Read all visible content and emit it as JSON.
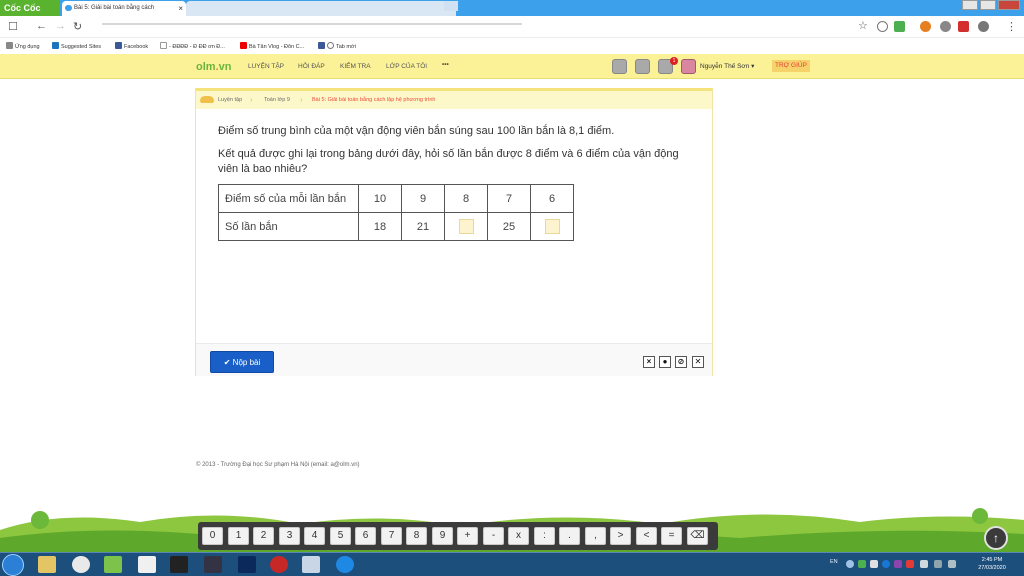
{
  "browser": {
    "brand": "Cốc Cốc",
    "tab_title": "Bài 5: Giải bài toán bằng cách",
    "tab_close": "×"
  },
  "bookmarks": [
    "Ứng dụng",
    "Suggested Sites",
    "Facebook",
    "- ĐĐĐĐ - Đ ĐĐ ơn Đ...",
    "Bà Tân Vlog - Đôn C...",
    "Tab mới"
  ],
  "site": {
    "logo_a": "olm",
    "logo_dot": ".",
    "logo_b": "vn",
    "nav": [
      "LUYỆN TẬP",
      "HỎI ĐÁP",
      "KIỂM TRA",
      "LỚP CỦA TÔI",
      "•••"
    ],
    "notification_count": "1",
    "user_name": "Nguyễn Thế Sơn ▾",
    "help": "TRỢ GIÚP"
  },
  "breadcrumb": [
    "Luyện tập",
    "Toán lớp 9",
    "Bài 5: Giải bài toán bằng cách lập hệ phương trình"
  ],
  "question": {
    "line1": "Điểm số trung bình của một vận động viên bắn súng sau 100 lần bắn là 8,1 điểm.",
    "line2": "Kết quả được ghi lại trong bảng dưới đây, hỏi số lần bắn được 8 điểm và 6 điểm của vận động viên là bao nhiêu?"
  },
  "table": {
    "row1_label": "Điểm số của mỗi lần bắn",
    "row1": [
      "10",
      "9",
      "8",
      "7",
      "6"
    ],
    "row2_label": "Số lần bắn",
    "row2": [
      "18",
      "21",
      "",
      "25",
      ""
    ]
  },
  "footer": {
    "submit": "✔ Nộp bài",
    "controls": [
      "×",
      "●",
      "⊘",
      "✕"
    ]
  },
  "copyright": "© 2013 - Trường Đại học Sư phạm Hà Nội (email: a@olm.vn)",
  "keypad": [
    "0",
    "1",
    "2",
    "3",
    "4",
    "5",
    "6",
    "7",
    "8",
    "9",
    "+",
    "-",
    "x",
    ":",
    ".",
    ",",
    ">",
    "<",
    "=",
    "⌫"
  ],
  "taskbar": {
    "lang": "EN",
    "time": "2:45 PM",
    "date": "27/03/2020"
  },
  "colors": {
    "brand_green": "#59b32e",
    "nav_yellow": "#fbf196",
    "submit_blue": "#1a5fc7",
    "help_red": "#e53935"
  }
}
